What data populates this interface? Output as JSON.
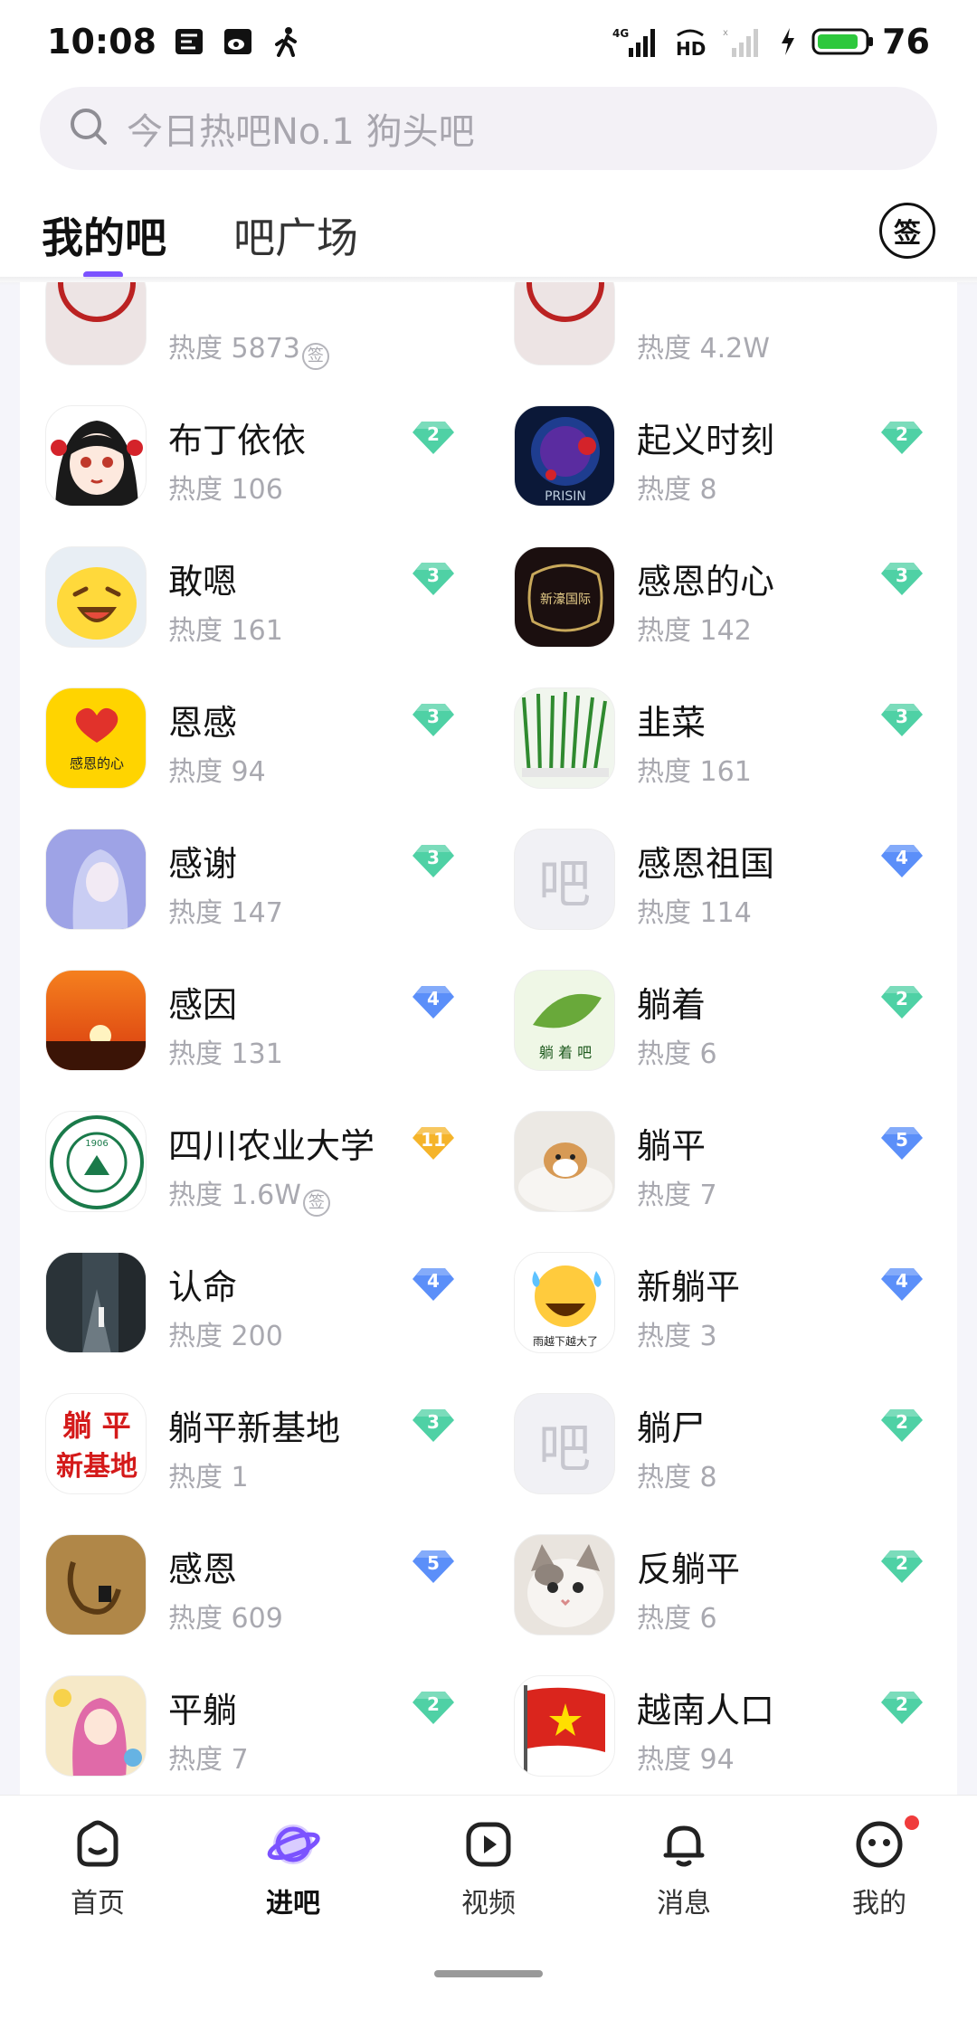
{
  "status_bar": {
    "time": "10:08",
    "battery": "76",
    "network": "4G",
    "hd_label": "HD",
    "icons": [
      "notification-icon",
      "weibo-icon",
      "walk-icon",
      "signal-icon",
      "hd-icon",
      "signal-weak-icon",
      "charging-icon",
      "battery-icon"
    ]
  },
  "search": {
    "placeholder": "今日热吧No.1 狗头吧",
    "icon": "search-icon"
  },
  "tabs": {
    "my_bars": "我的吧",
    "bar_square": "吧广场",
    "sign_label": "签"
  },
  "heat_prefix": "热度",
  "colors": {
    "accent": "#7b52ff",
    "badge_green": "#4fd1a5",
    "badge_blue": "#5b8ff9",
    "badge_gold": "#f5b42a"
  },
  "bars": [
    {
      "name": "",
      "heat": "热度 5873",
      "signed": true,
      "badge": "",
      "badge_color": "",
      "avatar": "partial"
    },
    {
      "name": "",
      "heat": "热度 4.2W",
      "signed": false,
      "badge": "",
      "badge_color": "",
      "avatar": "partial"
    },
    {
      "name": "布丁依依",
      "heat": "热度 106",
      "badge": "2",
      "badge_color": "green",
      "avatar": "anime-girl"
    },
    {
      "name": "起义时刻",
      "heat": "热度 8",
      "badge": "2",
      "badge_color": "green",
      "avatar": "space"
    },
    {
      "name": "敢嗯",
      "heat": "热度 161",
      "badge": "3",
      "badge_color": "green",
      "avatar": "laugh-emoji"
    },
    {
      "name": "感恩的心",
      "heat": "热度 142",
      "badge": "3",
      "badge_color": "green",
      "avatar": "dark-gold"
    },
    {
      "name": "恩感",
      "heat": "热度 94",
      "badge": "3",
      "badge_color": "green",
      "avatar": "heart-yellow"
    },
    {
      "name": "韭菜",
      "heat": "热度 161",
      "badge": "3",
      "badge_color": "green",
      "avatar": "chives"
    },
    {
      "name": "感谢",
      "heat": "热度 147",
      "badge": "3",
      "badge_color": "green",
      "avatar": "anime-blue"
    },
    {
      "name": "感恩祖国",
      "heat": "热度 114",
      "badge": "4",
      "badge_color": "blue",
      "avatar": "placeholder"
    },
    {
      "name": "感因",
      "heat": "热度 131",
      "badge": "4",
      "badge_color": "blue",
      "avatar": "sunset"
    },
    {
      "name": "躺着",
      "heat": "热度 6",
      "badge": "2",
      "badge_color": "green",
      "avatar": "leaf"
    },
    {
      "name": "四川农业大学",
      "heat": "热度 1.6W",
      "signed": true,
      "badge": "11",
      "badge_color": "gold",
      "avatar": "university"
    },
    {
      "name": "躺平",
      "heat": "热度 7",
      "badge": "5",
      "badge_color": "blue",
      "avatar": "dog"
    },
    {
      "name": "认命",
      "heat": "热度 200",
      "badge": "4",
      "badge_color": "blue",
      "avatar": "street"
    },
    {
      "name": "新躺平",
      "heat": "热度 3",
      "badge": "4",
      "badge_color": "blue",
      "avatar": "sweat-emoji"
    },
    {
      "name": "躺平新基地",
      "heat": "热度 1",
      "badge": "3",
      "badge_color": "green",
      "avatar": "text-red"
    },
    {
      "name": "躺尸",
      "heat": "热度 8",
      "badge": "2",
      "badge_color": "green",
      "avatar": "placeholder"
    },
    {
      "name": "感恩",
      "heat": "热度 609",
      "badge": "5",
      "badge_color": "blue",
      "avatar": "brown-art"
    },
    {
      "name": "反躺平",
      "heat": "热度 6",
      "badge": "2",
      "badge_color": "green",
      "avatar": "cat"
    },
    {
      "name": "平躺",
      "heat": "热度 7",
      "badge": "2",
      "badge_color": "green",
      "avatar": "anime-pink"
    },
    {
      "name": "越南人口",
      "heat": "热度 94",
      "badge": "2",
      "badge_color": "green",
      "avatar": "vietnam-flag"
    }
  ],
  "placeholder_glyph": "吧",
  "avatar_texts": {
    "heart_yellow": "感恩的心",
    "leaf": "躺 着 吧",
    "sweat": "雨越下越大了",
    "red_line1": "躺 平",
    "red_line2": "新基地",
    "space": "PRISIN",
    "dark_gold": "新濠国际",
    "university_year": "1906"
  },
  "bottom_nav": {
    "home": "首页",
    "bars": "进吧",
    "video": "视频",
    "messages": "消息",
    "mine": "我的"
  }
}
